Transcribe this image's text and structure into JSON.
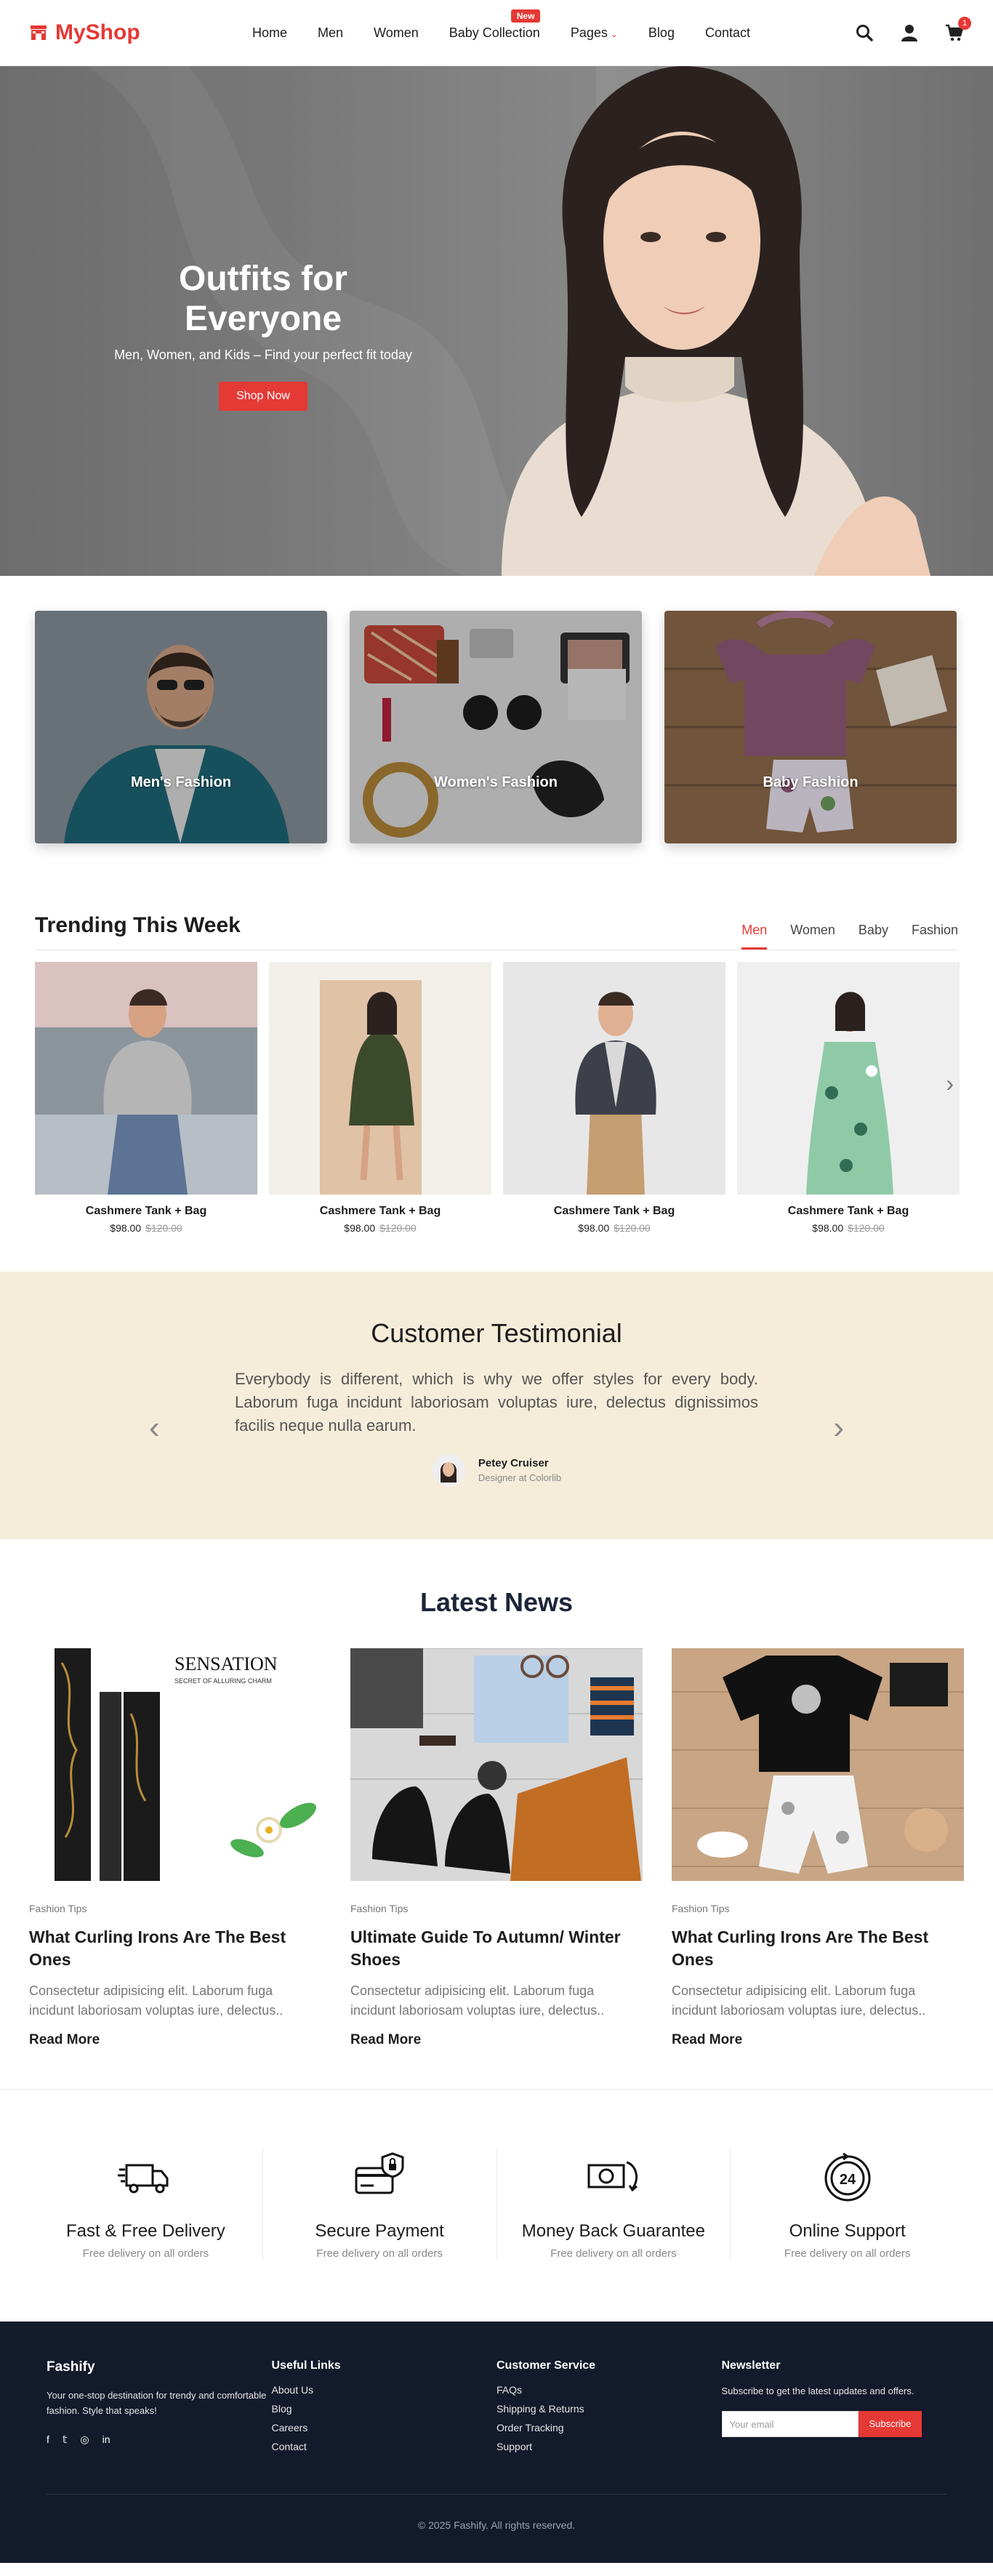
{
  "nav": {
    "logo": "MyShop",
    "items": [
      {
        "label": "Home"
      },
      {
        "label": "Men"
      },
      {
        "label": "Women"
      },
      {
        "label": "Baby Collection",
        "badge": "New"
      },
      {
        "label": "Pages"
      },
      {
        "label": "Blog"
      },
      {
        "label": "Contact"
      }
    ],
    "icons": [
      "search-icon",
      "user-icon",
      "cart-icon"
    ],
    "cart_count": "1"
  },
  "hero": {
    "title": "Outfits for Everyone",
    "subtitle": "Men, Women, and Kids – Find your perfect fit today",
    "button": "Shop Now"
  },
  "categories": [
    {
      "label": "Men's Fashion"
    },
    {
      "label": "Women's Fashion"
    },
    {
      "label": "Baby Fashion"
    }
  ],
  "trending": {
    "title": "Trending This Week",
    "tabs": [
      "Men",
      "Women",
      "Baby",
      "Fashion"
    ],
    "active_tab": "Men",
    "products": [
      {
        "name": "Cashmere Tank + Bag",
        "price": "$98.00",
        "old_price": "$120.00"
      },
      {
        "name": "Cashmere Tank + Bag",
        "price": "$98.00",
        "old_price": "$120.00"
      },
      {
        "name": "Cashmere Tank + Bag",
        "price": "$98.00",
        "old_price": "$120.00"
      },
      {
        "name": "Cashmere Tank + Bag",
        "price": "$98.00",
        "old_price": "$120.00"
      }
    ]
  },
  "testimonial": {
    "title": "Customer Testimonial",
    "quote": "Everybody is different, which is why we offer styles for every body. Laborum fuga incidunt laboriosam voluptas iure, delectus dignissimos facilis neque nulla earum.",
    "author": "Petey Cruiser",
    "role": "Designer at Colorlib"
  },
  "news": {
    "title": "Latest News",
    "posts": [
      {
        "category": "Fashion Tips",
        "title": "What Curling Irons Are The Best Ones",
        "excerpt": "Consectetur adipisicing elit. Laborum fuga incidunt laboriosam voluptas iure, delectus..",
        "read_more": "Read More",
        "image_text": "SENSATION",
        "image_subtext": "SECRET OF ALLURING CHARM"
      },
      {
        "category": "Fashion Tips",
        "title": "Ultimate Guide To Autumn/ Winter Shoes",
        "excerpt": "Consectetur adipisicing elit. Laborum fuga incidunt laboriosam voluptas iure, delectus..",
        "read_more": "Read More"
      },
      {
        "category": "Fashion Tips",
        "title": "What Curling Irons Are The Best Ones",
        "excerpt": "Consectetur adipisicing elit. Laborum fuga incidunt laboriosam voluptas iure, delectus..",
        "read_more": "Read More"
      }
    ]
  },
  "features": [
    {
      "title": "Fast & Free Delivery",
      "subtitle": "Free delivery on all orders",
      "icon": "truck-icon"
    },
    {
      "title": "Secure Payment",
      "subtitle": "Free delivery on all orders",
      "icon": "secure-card-icon"
    },
    {
      "title": "Money Back Guarantee",
      "subtitle": "Free delivery on all orders",
      "icon": "money-back-icon"
    },
    {
      "title": "Online Support",
      "subtitle": "Free delivery on all orders",
      "icon": "support-24-icon"
    }
  ],
  "footer": {
    "brand": "Fashify",
    "description": "Your one-stop destination for trendy and comfortable fashion. Style that speaks!",
    "social": [
      "facebook-icon",
      "twitter-icon",
      "instagram-icon",
      "linkedin-icon"
    ],
    "useful_links": {
      "title": "Useful Links",
      "items": [
        "About Us",
        "Blog",
        "Careers",
        "Contact"
      ]
    },
    "customer_service": {
      "title": "Customer Service",
      "items": [
        "FAQs",
        "Shipping & Returns",
        "Order Tracking",
        "Support"
      ]
    },
    "newsletter": {
      "title": "Newsletter",
      "text": "Subscribe to get the latest updates and offers.",
      "placeholder": "Your email",
      "button": "Subscribe"
    },
    "copyright": "© 2025 Fashify. All rights reserved."
  },
  "colors": {
    "accent": "#e53935",
    "footer_bg": "#131a2b",
    "testimonial_bg": "#f5ecd9",
    "news_title": "#1c2538"
  }
}
